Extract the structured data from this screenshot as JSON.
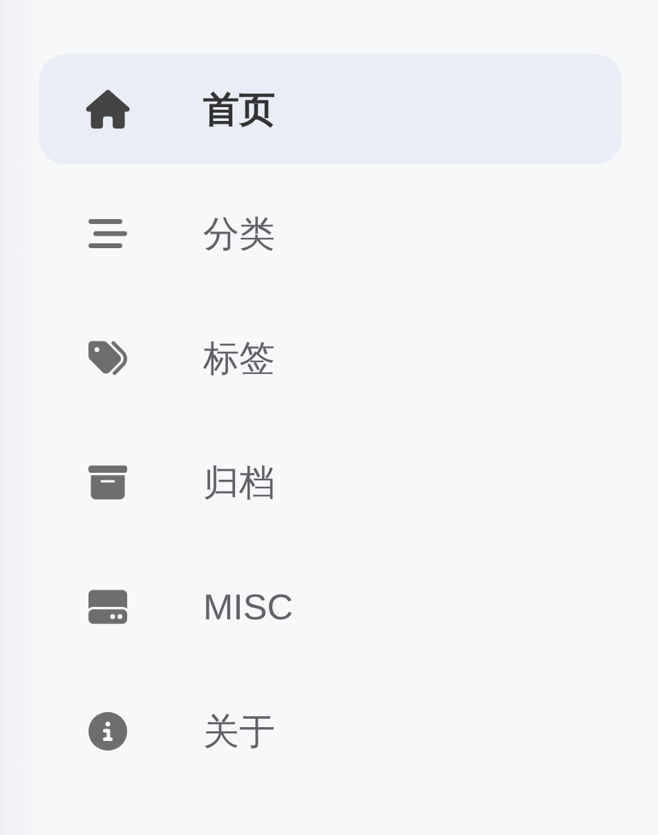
{
  "sidebar": {
    "items": [
      {
        "label": "首页",
        "selected": true
      },
      {
        "label": "分类",
        "selected": false
      },
      {
        "label": "标签",
        "selected": false
      },
      {
        "label": "归档",
        "selected": false
      },
      {
        "label": "MISC",
        "selected": false
      },
      {
        "label": "关于",
        "selected": false
      }
    ]
  }
}
